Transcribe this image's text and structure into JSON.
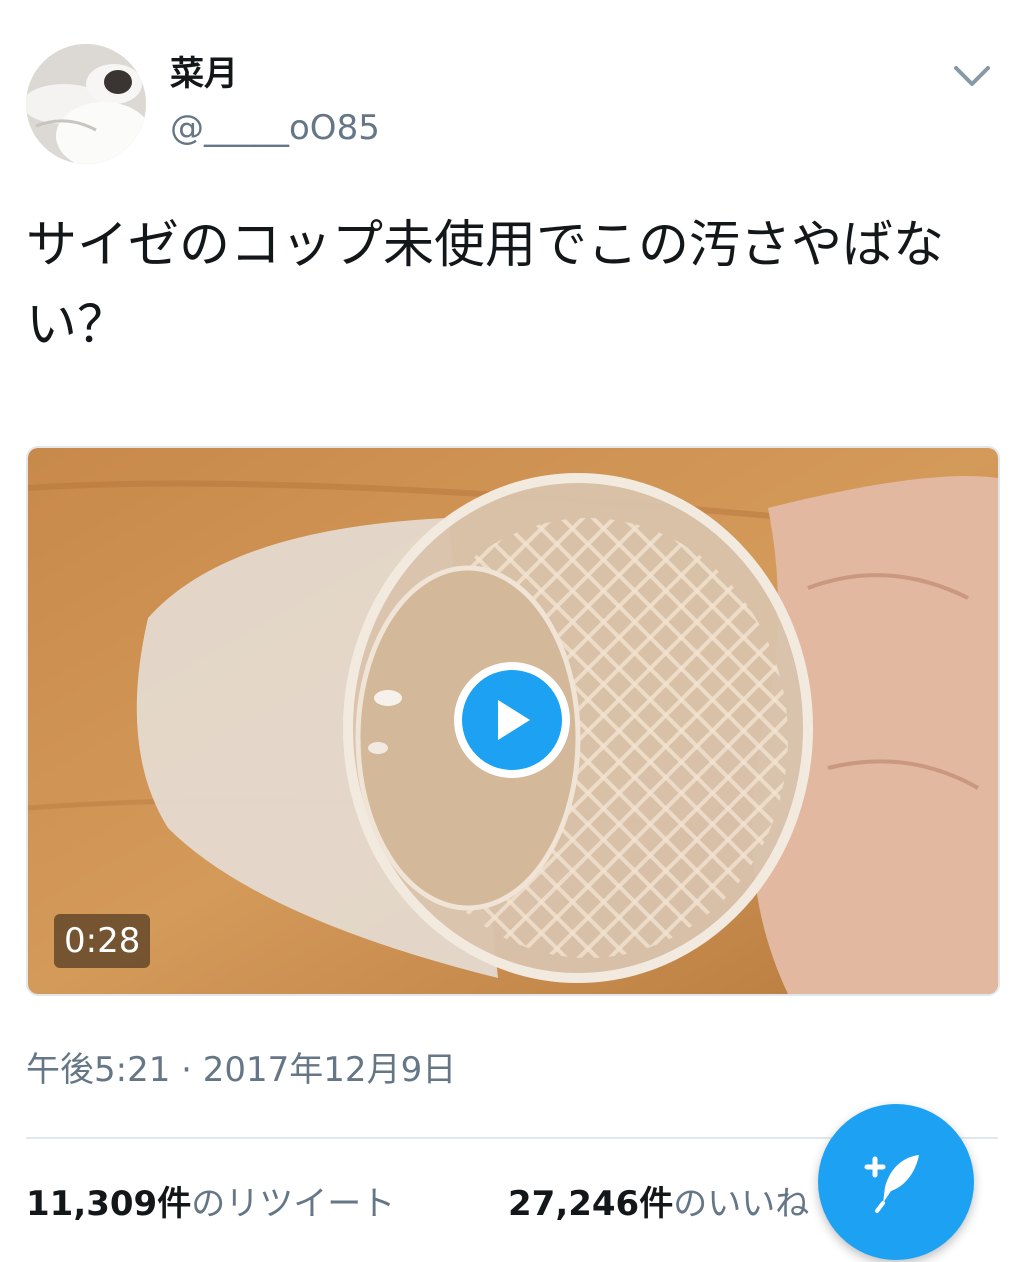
{
  "user": {
    "display_name": "菜月",
    "screen_name": "@_____oO85"
  },
  "tweet": {
    "text": "サイゼのコップ未使用でこの汚さやばない？",
    "timestamp": "午後5:21 · 2017年12月9日"
  },
  "media": {
    "duration": "0:28"
  },
  "stats": {
    "retweets_count": "11,309件",
    "retweets_label": "のリツイート",
    "likes_count": "27,246件",
    "likes_label": "のいいね"
  },
  "colors": {
    "accent": "#1da1f2",
    "secondary_text": "#657786",
    "divider": "#e1e8ed"
  },
  "icons": {
    "caret": "chevron-down-icon",
    "play": "play-icon",
    "compose": "compose-tweet-icon"
  }
}
